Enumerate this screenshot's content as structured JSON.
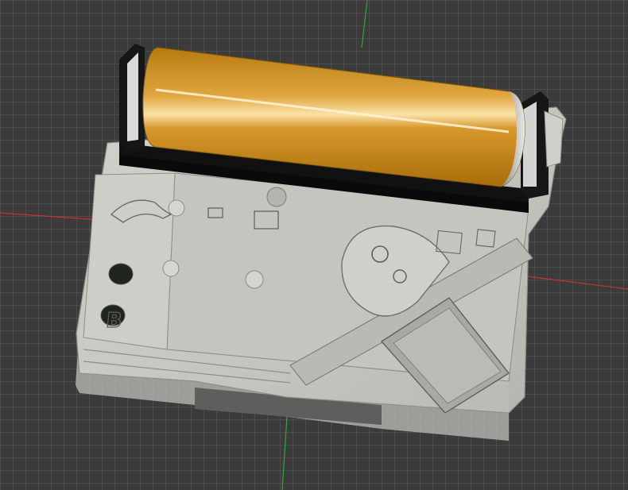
{
  "viewport": {
    "background": "#3b3b3b",
    "grid_color": "#5a5a5a",
    "axis_colors": {
      "x": "#c83232",
      "z": "#2ea83a"
    }
  },
  "model": {
    "housing_color": "#c9cac4",
    "battery_color": "#c98f16",
    "holder_color": "#111111",
    "engraved_letter": "B"
  }
}
